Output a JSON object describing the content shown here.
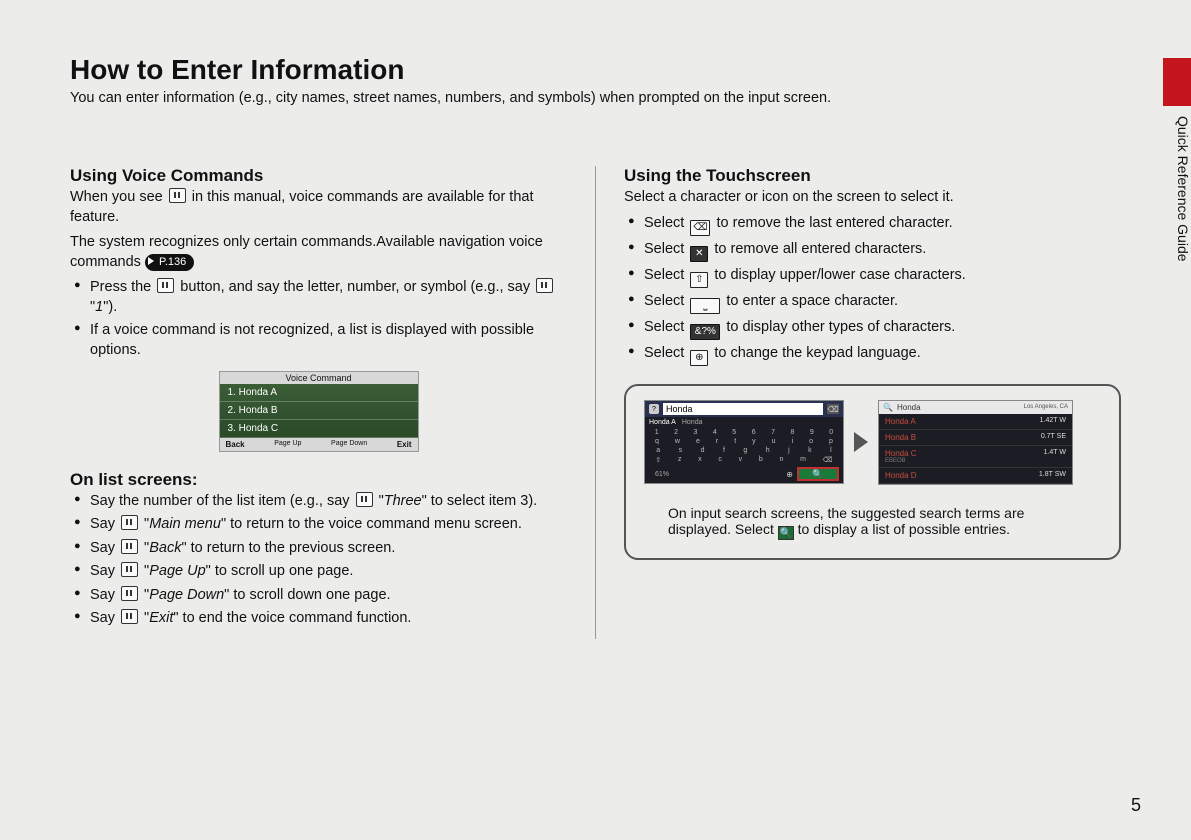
{
  "sideTab": "Quick Reference Guide",
  "title": "How to Enter Information",
  "intro": "You can enter information (e.g., city names, street names, numbers, and symbols) when prompted on the input screen.",
  "voice": {
    "heading": "Using Voice Commands",
    "p1a": "When you see ",
    "p1b": " in this manual, voice commands are available for that feature.",
    "p2": "The system recognizes only certain commands.Available navigation voice commands ",
    "pageRef": "P.136",
    "b1a": "Press the ",
    "b1b": " button, and say the letter, number, or symbol (e.g., say ",
    "b1c": " \"",
    "b1cmd": "1",
    "b1d": "\").",
    "b2": "If a voice command is not recognized, a list is displayed with possible options.",
    "vcHeader": "Voice Command",
    "vc1": "1. Honda A",
    "vc2": "2. Honda B",
    "vc3": "3. Honda C",
    "vcBack": "Back",
    "vcUp": "Page Up",
    "vcDown": "Page Down",
    "vcExit": "Exit"
  },
  "list": {
    "heading": "On list screens:",
    "i1a": "Say the number of the list item (e.g., say ",
    "i1b": " \"",
    "i1cmd": "Three",
    "i1c": "\" to select item 3).",
    "i2a": "Say ",
    "i2cmd": "Main menu",
    "i2b": "\" to return to the voice command menu screen.",
    "i3cmd": "Back",
    "i3b": "\" to return to the previous screen.",
    "i4cmd": "Page Up",
    "i4b": "\" to scroll up one page.",
    "i5cmd": "Page Down",
    "i5b": "\" to scroll down one page.",
    "i6cmd": "Exit",
    "i6b": "\" to end the voice command function."
  },
  "touch": {
    "heading": "Using the Touchscreen",
    "intro": "Select a character or icon on the screen to select it.",
    "sel": "Select ",
    "t1": " to remove the last entered character.",
    "t2": " to remove all entered characters.",
    "t3": " to display upper/lower case characters.",
    "t4": " to enter a space character.",
    "t5": " to display other types of characters.",
    "t6": " to change the keypad language.",
    "kDel": "⌫",
    "kX": "✕",
    "kShift": "⇧",
    "kSpace": "␣",
    "kSym": "&?%",
    "kGlobe": "⊕"
  },
  "mini": {
    "q": "?",
    "input": "Honda",
    "tabA": "Honda A",
    "tabB": "Honda",
    "pct": "61%",
    "loc": "Los Angeles, CA",
    "rA": "Honda A",
    "dA": "1.42T  W",
    "rB": "Honda B",
    "dB": "0.7T  SE",
    "rC": "Honda C",
    "dC": "1.4T  W",
    "rCsub": "EBEOB",
    "rD": "Honda D",
    "dD": "1.8T  SW",
    "searchQ": "Q"
  },
  "note": {
    "l1": "On input search screens, the suggested search terms are",
    "l2a": "displayed. Select ",
    "l2b": " to display a list of possible entries."
  },
  "pageNum": "5"
}
